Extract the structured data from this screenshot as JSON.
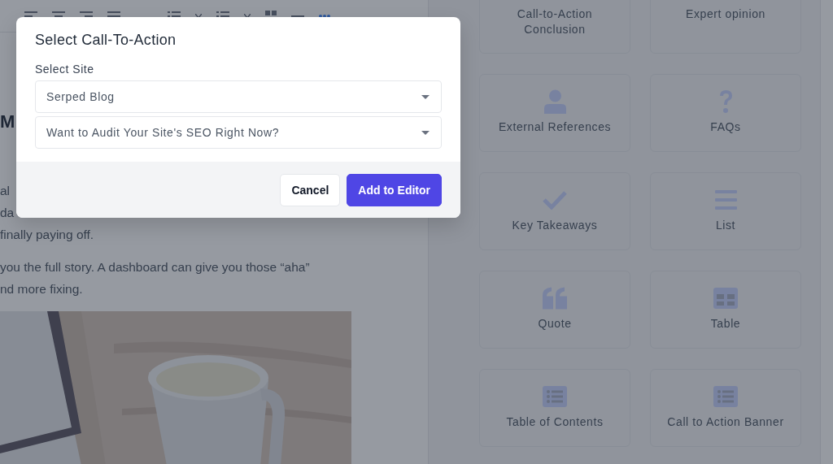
{
  "editor": {
    "heading": "M",
    "paragraphs": [
      [
        "al",
        "da",
        "finally paying off."
      ],
      [
        "you the full story. A dashboard can give you those “aha”",
        "nd more fixing."
      ]
    ],
    "image": {
      "kind": "picture"
    }
  },
  "blocks": [
    {
      "label": "Call-to-Action Conclusion"
    },
    {
      "label": "Expert opinion"
    },
    {
      "label": "External References",
      "kind": "person"
    },
    {
      "label": "FAQs",
      "kind": "question"
    },
    {
      "label": "Key Takeaways",
      "kind": "check"
    },
    {
      "label": "List",
      "kind": "list"
    },
    {
      "label": "Quote",
      "kind": "quote"
    },
    {
      "label": "Table",
      "kind": "table"
    },
    {
      "label": "Table of Contents",
      "kind": "toc"
    },
    {
      "label": "Call to Action Banner",
      "kind": "toc"
    }
  ],
  "modal": {
    "title": "Select Call-To-Action",
    "field_label": "Select Site",
    "selects": [
      {
        "value": "Serped Blog"
      },
      {
        "value": "Want to Audit Your Site's SEO Right Now?"
      }
    ],
    "buttons": [
      {
        "kind": "secondary",
        "label": "Cancel"
      },
      {
        "kind": "primary",
        "label": "Add to Editor"
      }
    ]
  }
}
